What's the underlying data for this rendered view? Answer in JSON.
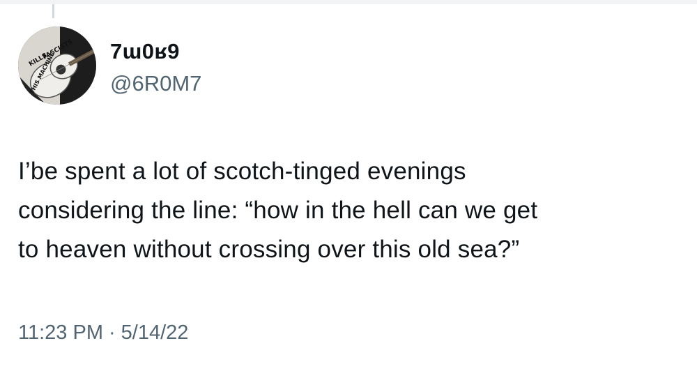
{
  "tweet": {
    "author": {
      "display_name": "7ɯ0ʁ9",
      "handle": "@6R0M7",
      "avatar_text": [
        "THIS MACHINE",
        "KILLS",
        "FASCISTS"
      ]
    },
    "text": "I’be spent a lot of scotch-tinged evenings\nconsidering the line: “how in the hell can we get\nto heaven without crossing over this old sea?”",
    "time": "11:23 PM",
    "separator": "·",
    "date": "5/14/22"
  }
}
